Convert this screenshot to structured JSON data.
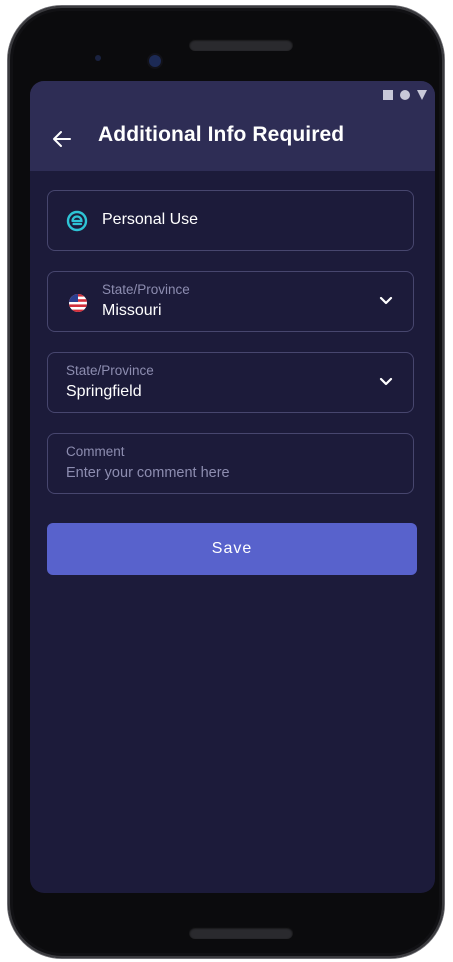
{
  "status_bar": {
    "icons": [
      "square-icon",
      "circle-icon",
      "triangle-icon"
    ]
  },
  "app_bar": {
    "title": "Additional Info Required",
    "back_icon": "arrow-left-icon"
  },
  "form": {
    "usage": {
      "value": "Personal Use",
      "icon": "brand-logo-icon"
    },
    "state": {
      "label": "State/Province",
      "value": "Missouri",
      "icon": "us-flag-icon"
    },
    "city": {
      "label": "State/Province",
      "value": "Springfield"
    },
    "comment": {
      "label": "Comment",
      "placeholder": "Enter your comment here"
    },
    "save_label": "Save"
  },
  "colors": {
    "background": "#1c1b3a",
    "app_bar": "#2e2d55",
    "accent": "#5862cc",
    "brand_icon": "#2ec4d6",
    "field_border": "#47466e",
    "muted_text": "#8d8db0"
  }
}
